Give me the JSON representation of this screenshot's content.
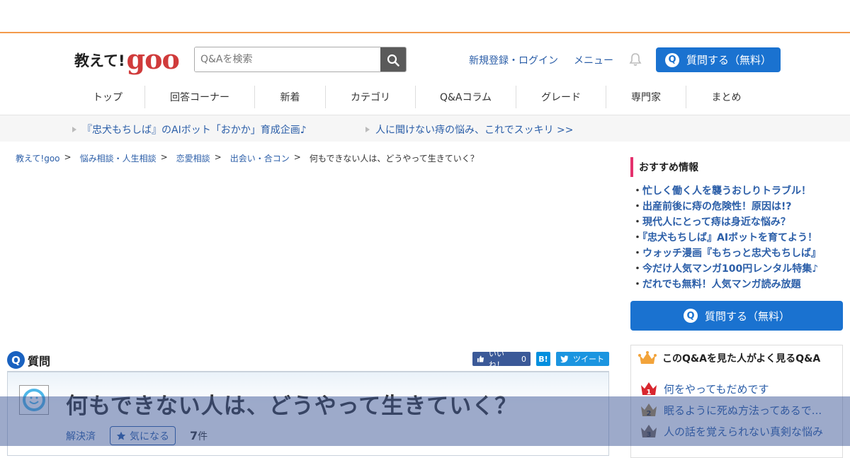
{
  "header": {
    "logo_text": "教えて!",
    "logo_brand": "goo",
    "search_placeholder": "Q&Aを検索",
    "register_login": "新規登録・ログイン",
    "menu": "メニュー",
    "ask_button": "質問する（無料）"
  },
  "nav": [
    "トップ",
    "回答コーナー",
    "新着",
    "カテゴリ",
    "Q&Aコラム",
    "グレード",
    "専門家",
    "まとめ"
  ],
  "promo": [
    "『忠犬もちしば』のAIボット「おかか」育成企画♪",
    "人に聞けない痔の悩み、これでスッキリ >>"
  ],
  "breadcrumb": [
    "教えて!goo",
    "悩み相談・人生相談",
    "恋愛相談",
    "出会い・合コン"
  ],
  "breadcrumb_current": "何もできない人は、どうやって生きていく？",
  "question": {
    "label": "質問",
    "title": "何もできない人は、どうやって生きていく？",
    "status": "解決済",
    "watch_label": "気になる",
    "count": "7",
    "count_unit": "件"
  },
  "social": {
    "like_label": "いいね！",
    "like_count": "0",
    "hatena": "B!",
    "tweet_label": "ツイート"
  },
  "sidebar": {
    "recommend_title": "おすすめ情報",
    "recommend_items": [
      "忙しく働く人を襲うおしりトラブル！",
      "出産前後に痔の危険性！原因は!?",
      "現代人にとって痔は身近な悩み？",
      "『忠犬もちしば』AIボットを育てよう！",
      "ウォッチ漫画『もちっと忠犬もちしば』",
      "今だけ人気マンガ100円レンタル特集♪",
      "だれでも無料！人気マンガ読み放題"
    ],
    "ask_button": "質問する（無料）",
    "ranking_title": "このQ&Aを見た人がよく見るQ&A",
    "ranking": [
      {
        "rank": "1",
        "title": "何をやってもだめです"
      },
      {
        "rank": "2",
        "title": "眠るように死ぬ方法ってあるで..."
      },
      {
        "rank": "3",
        "title": "人の話を覚えられない真剣な悩み"
      }
    ]
  },
  "colors": {
    "accent_orange": "#f39a4b",
    "link_blue": "#2b5ea8",
    "button_blue": "#1a72d0",
    "goo_red": "#d03b3b",
    "recommend_bar": "#e4316d"
  }
}
